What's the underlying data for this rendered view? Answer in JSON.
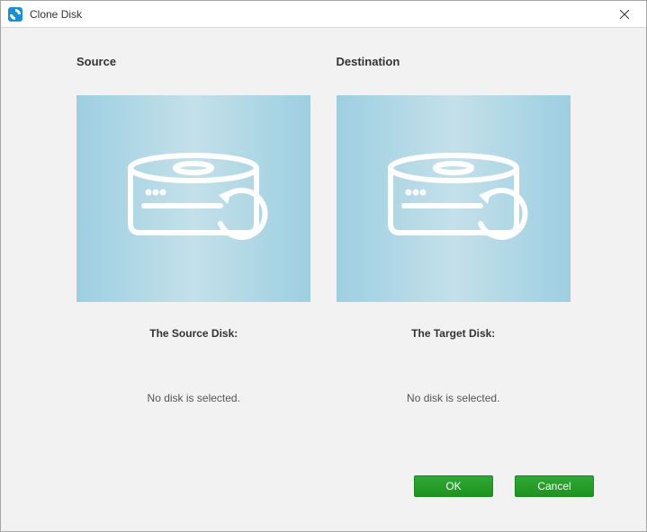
{
  "window": {
    "title": "Clone Disk"
  },
  "source": {
    "header": "Source",
    "label": "The Source Disk:",
    "status": "No disk is selected."
  },
  "destination": {
    "header": "Destination",
    "label": "The Target Disk:",
    "status": "No disk is selected."
  },
  "buttons": {
    "ok": "OK",
    "cancel": "Cancel"
  }
}
